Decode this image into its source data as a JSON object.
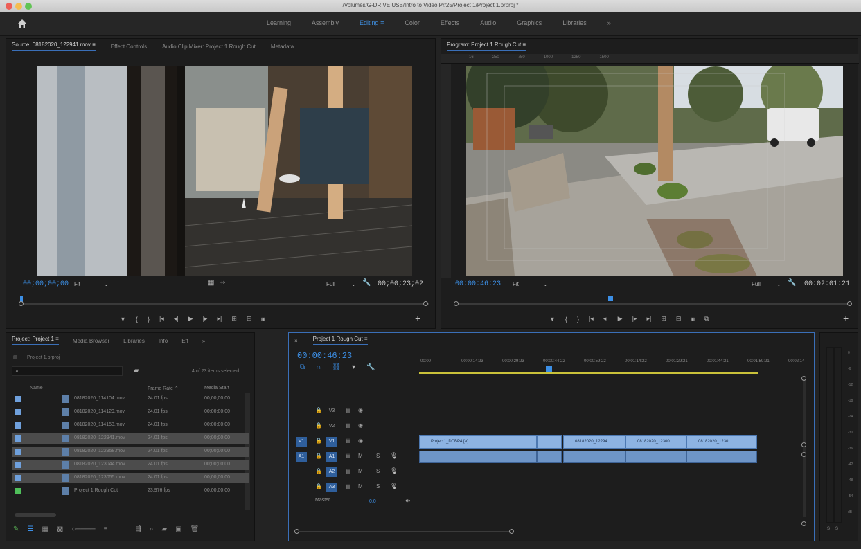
{
  "window": {
    "title": "/Volumes/G-DRIVE USB/Intro to Video Pr/25/Project 1/Project 1.prproj *"
  },
  "workspaces": {
    "tabs": [
      {
        "label": "Learning"
      },
      {
        "label": "Assembly"
      },
      {
        "label": "Editing  ≡"
      },
      {
        "label": "Color"
      },
      {
        "label": "Effects"
      },
      {
        "label": "Audio"
      },
      {
        "label": "Graphics"
      },
      {
        "label": "Libraries"
      },
      {
        "label": "»"
      }
    ],
    "active": "Editing"
  },
  "source": {
    "tabs": [
      "Source: 08182020_122941.mov  ≡",
      "Effect Controls",
      "Audio Clip Mixer: Project 1 Rough Cut",
      "Metadata"
    ],
    "timecode_in": "00;00;00;00",
    "fit": "Fit",
    "resolution": "Full",
    "timecode_out": "00;00;23;02",
    "playhead": 0.0
  },
  "program": {
    "tab": "Program: Project 1 Rough Cut  ≡",
    "timecode_in": "00:00:46:23",
    "fit": "Fit",
    "resolution": "Full",
    "timecode_out": "00:02:01:21",
    "playhead": 0.39,
    "ruler_ticks": [
      "16",
      "",
      "250",
      "",
      "750",
      "",
      "1000",
      "",
      "1250",
      "",
      "1500",
      ""
    ]
  },
  "project": {
    "tabs": [
      "Project: Project 1  ≡",
      "Media Browser",
      "Libraries",
      "Info",
      "Eff",
      "»"
    ],
    "file": "Project 1.prproj",
    "search_placeholder": "",
    "count": "4 of 23 items selected",
    "columns": {
      "name": "Name",
      "frame_rate": "Frame Rate ⌃",
      "media_start": "Media Start"
    },
    "rows": [
      {
        "name": "08182020_114104.mov",
        "fps": "24.01 fps",
        "start": "00;00;00;00",
        "selected": false,
        "color": "#6fa0dc"
      },
      {
        "name": "08182020_114129.mov",
        "fps": "24.01 fps",
        "start": "00;00;00;00",
        "selected": false,
        "color": "#6fa0dc"
      },
      {
        "name": "08182020_114153.mov",
        "fps": "24.01 fps",
        "start": "00;00;00;00",
        "selected": false,
        "color": "#6fa0dc"
      },
      {
        "name": "08182020_122941.mov",
        "fps": "24.01 fps",
        "start": "00;00;00;00",
        "selected": true,
        "color": "#6fa0dc"
      },
      {
        "name": "08182020_122958.mov",
        "fps": "24.01 fps",
        "start": "00;00;00;00",
        "selected": true,
        "color": "#6fa0dc"
      },
      {
        "name": "08182020_123044.mov",
        "fps": "24.01 fps",
        "start": "00;00;00;00",
        "selected": true,
        "color": "#6fa0dc"
      },
      {
        "name": "08182020_123055.mov",
        "fps": "24.01 fps",
        "start": "00;00;00;00",
        "selected": true,
        "color": "#6fa0dc"
      },
      {
        "name": "Project 1 Rough Cut",
        "fps": "23.976 fps",
        "start": "00:00:00:00",
        "selected": false,
        "color": "#4fbf5a"
      }
    ]
  },
  "timeline": {
    "tab": "Project 1 Rough Cut  ≡",
    "timecode": "00:00:46:23",
    "ruler": [
      "00:00",
      "00:00:14:23",
      "00:00:29:23",
      "00:00:44:22",
      "00:00:59:22",
      "00:01:14:22",
      "00:01:29:21",
      "00:01:44:21",
      "00:01:59:21",
      "00:02:14"
    ],
    "tracks": [
      "V3",
      "V2",
      "V1",
      "A1",
      "A2",
      "A3"
    ],
    "master": "Master",
    "master_value": "0.0",
    "clips": [
      {
        "label": "Project1_DCBP4 [V]"
      },
      {
        "label": ""
      },
      {
        "label": "08182020_12294"
      },
      {
        "label": "08182020_12300"
      },
      {
        "label": "08182020_1230"
      }
    ]
  },
  "meter": {
    "scale": [
      "0",
      "-6",
      "-12",
      "-18",
      "-24",
      "-30",
      "-36",
      "-42",
      "-48",
      "-54",
      "dB"
    ],
    "buttons": [
      "S",
      "S"
    ]
  }
}
